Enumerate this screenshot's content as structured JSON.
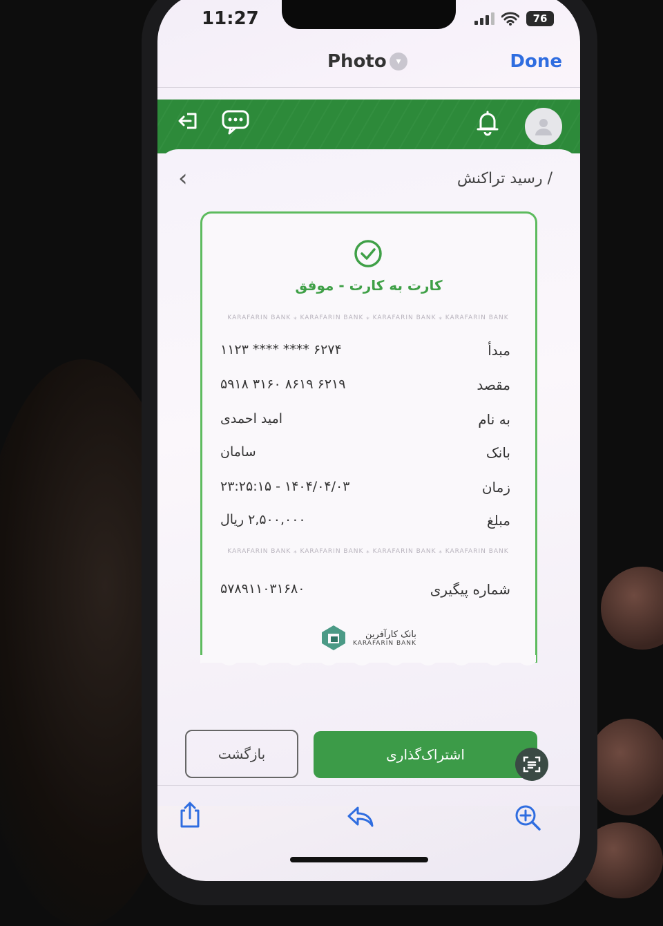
{
  "status_bar": {
    "time": "11:27",
    "battery": "76"
  },
  "photo_header": {
    "title": "Photo",
    "done_label": "Done"
  },
  "app_bar": {
    "logout_icon": "logout-icon",
    "chat_icon": "chat-icon",
    "bell_icon": "bell-icon",
    "avatar_icon": "user-avatar-icon"
  },
  "page": {
    "breadcrumb": "/  رسید تراکنش"
  },
  "receipt": {
    "status_text": "کارت به کارت - موفق",
    "ribbon_text": "KARAFARIN BANK ⁎ KARAFARIN BANK ⁎ KARAFARIN BANK ⁎ KARAFARIN BANK",
    "rows": [
      {
        "label": "مبدأ",
        "value": "۶۲۷۴   ****   ****   ۱۱۲۳"
      },
      {
        "label": "مقصد",
        "value": "۶۲۱۹   ۸۶۱۹   ۳۱۶۰   ۵۹۱۸"
      },
      {
        "label": "به نام",
        "value": "امید احمدی"
      },
      {
        "label": "بانک",
        "value": "سامان"
      },
      {
        "label": "زمان",
        "value": "۱۴۰۴/۰۴/۰۳ - ۲۳:۲۵:۱۵"
      },
      {
        "label": "مبلغ",
        "value": "۲,۵۰۰,۰۰۰ ریال"
      }
    ],
    "tracking": {
      "label": "شماره پیگیری",
      "value": "۵۷۸۹۱۱۰۳۱۶۸۰"
    },
    "bank_logo": {
      "fa": "بانک کارآفرین",
      "en": "KARAFARIN BANK"
    }
  },
  "buttons": {
    "back": "بازگشت",
    "share": "اشتراک‌گذاری"
  },
  "colors": {
    "brand_green": "#2d8a3a",
    "success_green": "#3fa047",
    "ios_blue": "#2f6de0"
  },
  "toolbar": {
    "share_icon": "share-icon",
    "reply_icon": "reply-icon",
    "zoom_icon": "zoom-in-icon"
  }
}
